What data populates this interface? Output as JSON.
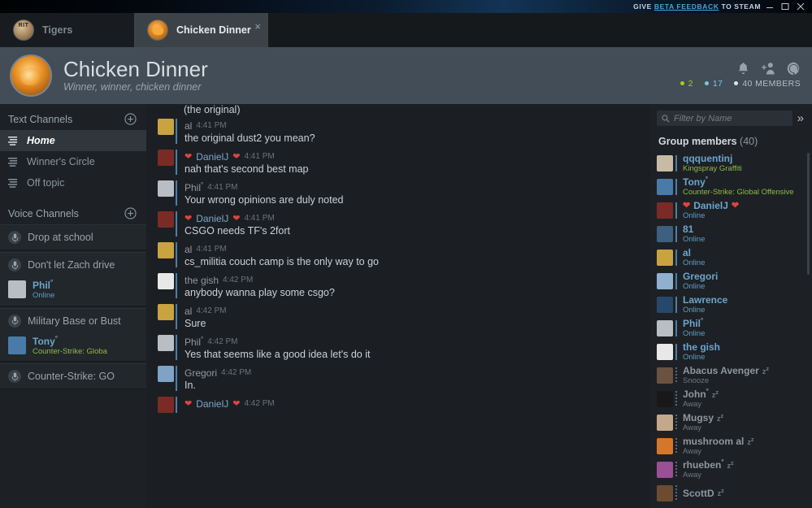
{
  "titlebar": {
    "give": "GIVE",
    "link": "BETA FEEDBACK",
    "to_steam": "TO STEAM",
    "minimize": "minimize-icon",
    "maximize": "maximize-icon",
    "close": "close-icon"
  },
  "tabs": [
    {
      "label": "Tigers",
      "icon": "tigers-avatar",
      "active": false
    },
    {
      "label": "Chicken Dinner",
      "icon": "chicken-avatar",
      "active": true,
      "close": "×"
    }
  ],
  "group_header": {
    "title": "Chicken Dinner",
    "subtitle": "Winner, winner, chicken dinner",
    "icons": [
      "bell-icon",
      "add-friend-icon",
      "settings-icon"
    ],
    "counts": {
      "in_game": "2",
      "online": "17",
      "members": "40 MEMBERS"
    },
    "colors": {
      "in_game": "#a4d007",
      "online": "#7fc3e8",
      "members": "#b4bcc4"
    }
  },
  "sidebar": {
    "text_channels_title": "Text Channels",
    "voice_channels_title": "Voice Channels",
    "add_icon": "plus-circle-icon",
    "text_channels": [
      {
        "name": "Home",
        "active": true
      },
      {
        "name": "Winner's Circle",
        "active": false
      },
      {
        "name": "Off topic",
        "active": false
      }
    ],
    "voice_channels": [
      {
        "name": "Drop at school",
        "users": []
      },
      {
        "name": "Don't let Zach drive",
        "users": [
          {
            "name": "Phil",
            "star": "°",
            "status": "Online",
            "status_type": "online",
            "avatar": "#b9bec4"
          }
        ]
      },
      {
        "name": "Military Base or Bust",
        "users": [
          {
            "name": "Tony",
            "star": "°",
            "status": "Counter-Strike: Globa",
            "status_type": "game",
            "avatar": "#4a7ba8"
          }
        ]
      },
      {
        "name": "Counter-Strike: GO",
        "users": []
      }
    ]
  },
  "chat": {
    "partial_top": "(the original)",
    "messages": [
      {
        "author": "al",
        "star": "",
        "hearts": false,
        "time": "4:41 PM",
        "text": "the original dust2 you mean?",
        "avatar": "#c9a33f",
        "name_color": "grey"
      },
      {
        "author": "DanielJ",
        "star": "",
        "hearts": true,
        "time": "4:41 PM",
        "text": "nah that's second best map",
        "avatar": "#7a2b25",
        "name_color": "blue"
      },
      {
        "author": "Phil",
        "star": "°",
        "hearts": false,
        "time": "4:41 PM",
        "text": "Your wrong opinions are duly noted",
        "avatar": "#b9bec4",
        "name_color": "grey"
      },
      {
        "author": "DanielJ",
        "star": "",
        "hearts": true,
        "time": "4:41 PM",
        "text": "CSGO needs TF's 2fort",
        "avatar": "#7a2b25",
        "name_color": "blue"
      },
      {
        "author": "al",
        "star": "",
        "hearts": false,
        "time": "4:41 PM",
        "text": "cs_militia couch camp is the only way to go",
        "avatar": "#c9a33f",
        "name_color": "grey"
      },
      {
        "author": "the gish",
        "star": "",
        "hearts": false,
        "time": "4:42 PM",
        "text": "anybody wanna play some csgo?",
        "avatar": "#e8e8e8",
        "name_color": "grey"
      },
      {
        "author": "al",
        "star": "",
        "hearts": false,
        "time": "4:42 PM",
        "text": "Sure",
        "avatar": "#c9a33f",
        "name_color": "grey"
      },
      {
        "author": "Phil",
        "star": "°",
        "hearts": false,
        "time": "4:42 PM",
        "text": "Yes that seems like a good idea let's do it",
        "avatar": "#b9bec4",
        "name_color": "grey"
      },
      {
        "author": "Gregori",
        "star": "",
        "hearts": false,
        "time": "4:42 PM",
        "text": "In.",
        "avatar": "#7ea3c4",
        "name_color": "grey"
      },
      {
        "author": "DanielJ",
        "star": "",
        "hearts": true,
        "time": "4:42 PM",
        "text": "",
        "avatar": "#7a2b25",
        "name_color": "blue"
      }
    ]
  },
  "members_panel": {
    "filter_placeholder": "Filter by Name",
    "search_icon": "search-icon",
    "collapse_icon": "chevron-double-right-icon",
    "heading": "Group members",
    "count": "(40)",
    "members": [
      {
        "name": "qqquentinj",
        "star": "",
        "status": "Kingspray Graffiti",
        "status_type": "game",
        "avatar": "#c8bba6",
        "accent": "solid",
        "name_color": "blue",
        "zzz": false
      },
      {
        "name": "Tony",
        "star": "°",
        "status": "Counter-Strike: Global Offensive",
        "status_type": "game",
        "avatar": "#4a7ba8",
        "accent": "solid",
        "name_color": "blue",
        "zzz": false
      },
      {
        "name": "DanielJ",
        "star": "",
        "status": "Online",
        "status_type": "online",
        "avatar": "#7a2b25",
        "accent": "solid",
        "name_color": "blue",
        "hearts": true,
        "zzz": false
      },
      {
        "name": "81",
        "star": "",
        "status": "Online",
        "status_type": "online",
        "avatar": "#3d5f80",
        "accent": "solid",
        "name_color": "blue",
        "zzz": false
      },
      {
        "name": "al",
        "star": "",
        "status": "Online",
        "status_type": "online",
        "avatar": "#c9a33f",
        "accent": "solid",
        "name_color": "blue",
        "zzz": false
      },
      {
        "name": "Gregori",
        "star": "",
        "status": "Online",
        "status_type": "online",
        "avatar": "#8fb0cf",
        "accent": "solid",
        "name_color": "blue",
        "zzz": false
      },
      {
        "name": "Lawrence",
        "star": "",
        "status": "Online",
        "status_type": "online",
        "avatar": "#27486b",
        "accent": "solid",
        "name_color": "blue",
        "zzz": false
      },
      {
        "name": "Phil",
        "star": "°",
        "status": "Online",
        "status_type": "online",
        "avatar": "#b9bec4",
        "accent": "solid",
        "name_color": "blue",
        "zzz": false
      },
      {
        "name": "the gish",
        "star": "",
        "status": "Online",
        "status_type": "online",
        "avatar": "#e8e8e8",
        "accent": "solid",
        "name_color": "blue",
        "zzz": false
      },
      {
        "name": "Abacus Avenger",
        "star": "",
        "status": "Snooze",
        "status_type": "away",
        "avatar": "#6a5240",
        "accent": "dotted",
        "name_color": "grey",
        "zzz": true
      },
      {
        "name": "John",
        "star": "°",
        "status": "Away",
        "status_type": "away",
        "avatar": "#181818",
        "accent": "dotted",
        "name_color": "grey",
        "zzz": true
      },
      {
        "name": "Mugsy",
        "star": "",
        "status": "Away",
        "status_type": "away",
        "avatar": "#c4a88c",
        "accent": "dotted",
        "name_color": "grey",
        "zzz": true
      },
      {
        "name": "mushroom al",
        "star": "",
        "status": "Away",
        "status_type": "away",
        "avatar": "#d4772a",
        "accent": "dotted",
        "name_color": "grey",
        "zzz": true
      },
      {
        "name": "rhueben",
        "star": "°",
        "status": "Away",
        "status_type": "away",
        "avatar": "#9b4f94",
        "accent": "dotted",
        "name_color": "grey",
        "zzz": true
      },
      {
        "name": "ScottD",
        "star": "",
        "status": "",
        "status_type": "away",
        "avatar": "#6d4b31",
        "accent": "dotted",
        "name_color": "grey",
        "zzz": true
      }
    ]
  }
}
